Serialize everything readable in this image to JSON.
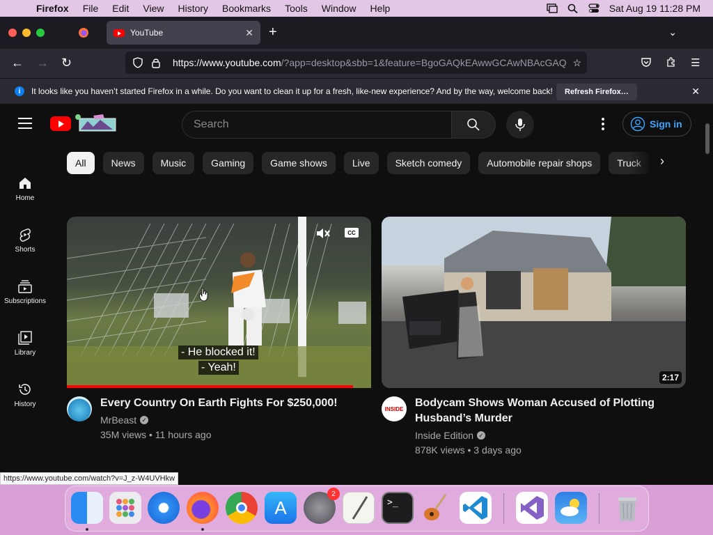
{
  "menubar": {
    "app_name": "Firefox",
    "items": [
      "File",
      "Edit",
      "View",
      "History",
      "Bookmarks",
      "Tools",
      "Window",
      "Help"
    ],
    "datetime": "Sat Aug 19  11:28 PM"
  },
  "browser": {
    "tab_title": "YouTube",
    "url_host": "https://www.youtube.com",
    "url_path": "/?app=desktop&sbb=1&feature=BgoGAQkEAwwGCAwNBAcGAQ",
    "notice": "It looks like you haven’t started Firefox in a while. Do you want to clean it up for a fresh, like-new experience? And by the way, welcome back!",
    "notice_button": "Refresh Firefox…",
    "status_url": "https://www.youtube.com/watch?v=J_z-W4UVHkw"
  },
  "youtube": {
    "search_placeholder": "Search",
    "signin_label": "Sign in",
    "sidebar": [
      {
        "label": "Home",
        "icon": "home-icon"
      },
      {
        "label": "Shorts",
        "icon": "shorts-icon"
      },
      {
        "label": "Subscriptions",
        "icon": "subscriptions-icon"
      },
      {
        "label": "Library",
        "icon": "library-icon"
      },
      {
        "label": "History",
        "icon": "history-icon"
      }
    ],
    "chips": [
      "All",
      "News",
      "Music",
      "Gaming",
      "Game shows",
      "Live",
      "Sketch comedy",
      "Automobile repair shops",
      "Truck"
    ],
    "videos": [
      {
        "title": "Every Country On Earth Fights For $250,000!",
        "channel": "MrBeast",
        "meta": "35M views • 11 hours ago",
        "caption_line1": "- He blocked it!",
        "caption_line2": "- Yeah!",
        "cc_label": "CC",
        "progress": 0.94
      },
      {
        "title_line1": "Bodycam Shows Woman Accused of Plotting",
        "title_line2": "Husband’s Murder",
        "channel": "Inside Edition",
        "meta": "878K views • 3 days ago",
        "duration": "2:17",
        "avatar_text": "INSIDE"
      }
    ]
  },
  "dock": {
    "badge_count": "2",
    "apps": [
      "Finder",
      "Launchpad",
      "Safari",
      "Firefox",
      "Chrome",
      "App Store",
      "System Settings",
      "TextEdit",
      "Terminal",
      "GarageBand",
      "Visual Studio Code",
      "Visual Studio",
      "Weather",
      "Trash"
    ]
  }
}
